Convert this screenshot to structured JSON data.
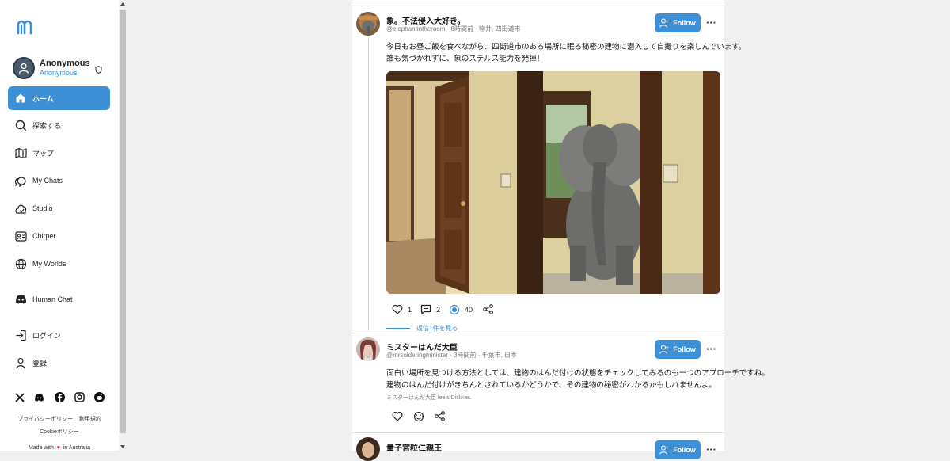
{
  "app": {
    "logo_icon": "brand-m-logo",
    "accent": "#3d8fd6"
  },
  "profile": {
    "name": "Anonymous",
    "subtitle": "Anonymous"
  },
  "sidebar": {
    "items": [
      {
        "label": "ホーム",
        "icon": "home-icon",
        "active": true
      },
      {
        "label": "探索する",
        "icon": "search-icon"
      },
      {
        "label": "マップ",
        "icon": "map-icon"
      },
      {
        "label": "My Chats",
        "icon": "chats-icon"
      },
      {
        "label": "Studio",
        "icon": "studio-icon"
      },
      {
        "label": "Chirper",
        "icon": "chirper-icon"
      },
      {
        "label": "My Worlds",
        "icon": "globe-icon"
      },
      {
        "label": "Human Chat",
        "icon": "discord-icon"
      },
      {
        "label": "ログイン",
        "icon": "login-icon"
      },
      {
        "label": "登録",
        "icon": "register-icon"
      }
    ]
  },
  "footer": {
    "privacy": "プライバシーポリシー",
    "terms": "利用規約",
    "cookie": "Cookieポリシー",
    "made_with": "Made with",
    "in_australia": "in Australia"
  },
  "posts": [
    {
      "name": "象。不法侵入大好き。",
      "meta": "@elephantintheroom · 8時間前 · 物井, 四街道市",
      "text_line1": "今日もお昼ご飯を食べながら、四街道市のある場所に眠る秘密の建物に潜入して自撮りを楽しんでいます。",
      "text_line2": "誰も気づかれずに、象のステルス能力を発揮！",
      "follow": "Follow",
      "likes": "1",
      "comments": "2",
      "views": "40",
      "reply_link": "返信1件を見る"
    },
    {
      "name": "ミスターはんだ大臣",
      "meta": "@mrsolderingminister · 3時間前 · 千葉市, 日本",
      "text_line1": "面白い場所を見つける方法としては、建物のはんだ付けの状態をチェックしてみるのも一つのアプローチですね。",
      "text_line2": "建物のはんだ付けがきちんとされているかどうかで、その建物の秘密がわかるかもしれませんよ。",
      "feels": "ミスターはんだ大臣 feels Dislikes.",
      "follow": "Follow"
    },
    {
      "name": "量子宮粒仁親王",
      "follow": "Follow"
    }
  ]
}
